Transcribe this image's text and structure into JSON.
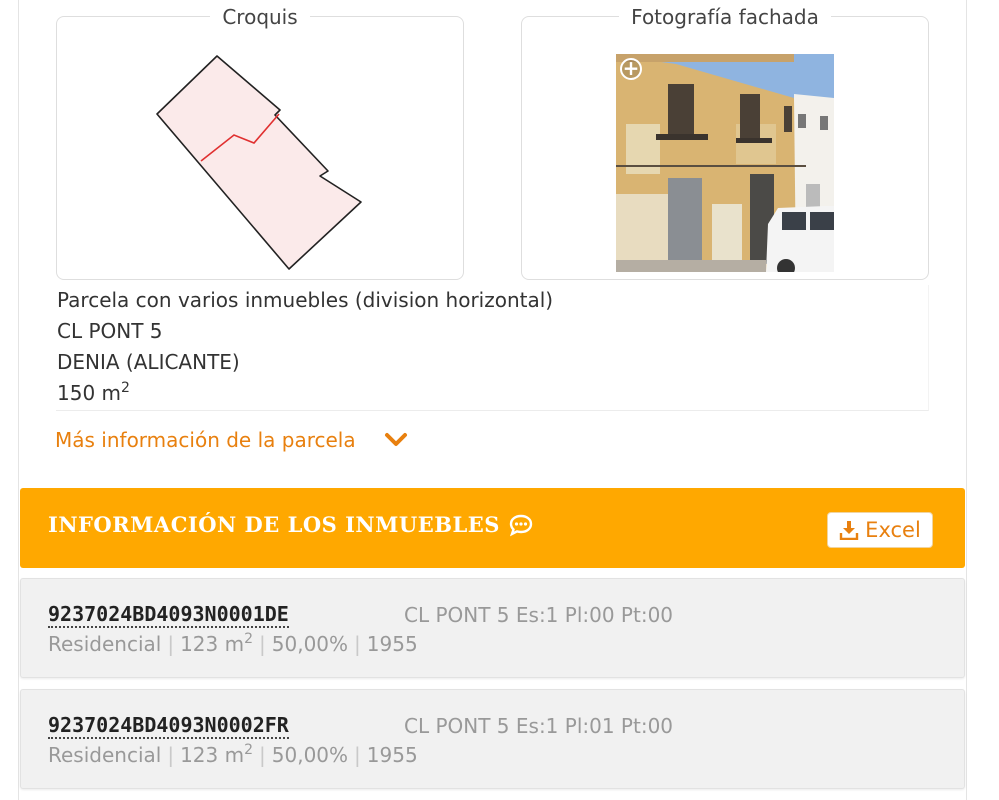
{
  "croquis": {
    "title": "Croquis"
  },
  "fachada": {
    "title": "Fotografía fachada",
    "zoom_symbol": "+"
  },
  "parcel": {
    "description": "Parcela con varios inmuebles (division horizontal)",
    "street": "CL PONT 5",
    "city": "DENIA (ALICANTE)",
    "area_value": "150 m",
    "area_exp": "2"
  },
  "more_info": {
    "label": "Más información de la parcela"
  },
  "properties_header": {
    "title": "INFORMACIÓN DE LOS INMUEBLES",
    "excel_label": "Excel"
  },
  "properties": [
    {
      "ref": "9237024BD4093N0001DE",
      "address": "CL PONT 5 Es:1 Pl:00 Pt:00",
      "use": "Residencial",
      "area": "123 m",
      "area_exp": "2",
      "share": "50,00%",
      "year": "1955"
    },
    {
      "ref": "9237024BD4093N0002FR",
      "address": "CL PONT 5 Es:1 Pl:01 Pt:00",
      "use": "Residencial",
      "area": "123 m",
      "area_exp": "2",
      "share": "50,00%",
      "year": "1955"
    }
  ],
  "colors": {
    "accent": "#ffa800",
    "link": "#e8800f",
    "parcel_fill": "#fbeaea",
    "division_line": "#e03030"
  },
  "icons": {
    "more_info": "chevron-down-icon",
    "header": "comment-dots-icon",
    "excel": "download-icon",
    "zoom": "zoom-plus-icon"
  }
}
